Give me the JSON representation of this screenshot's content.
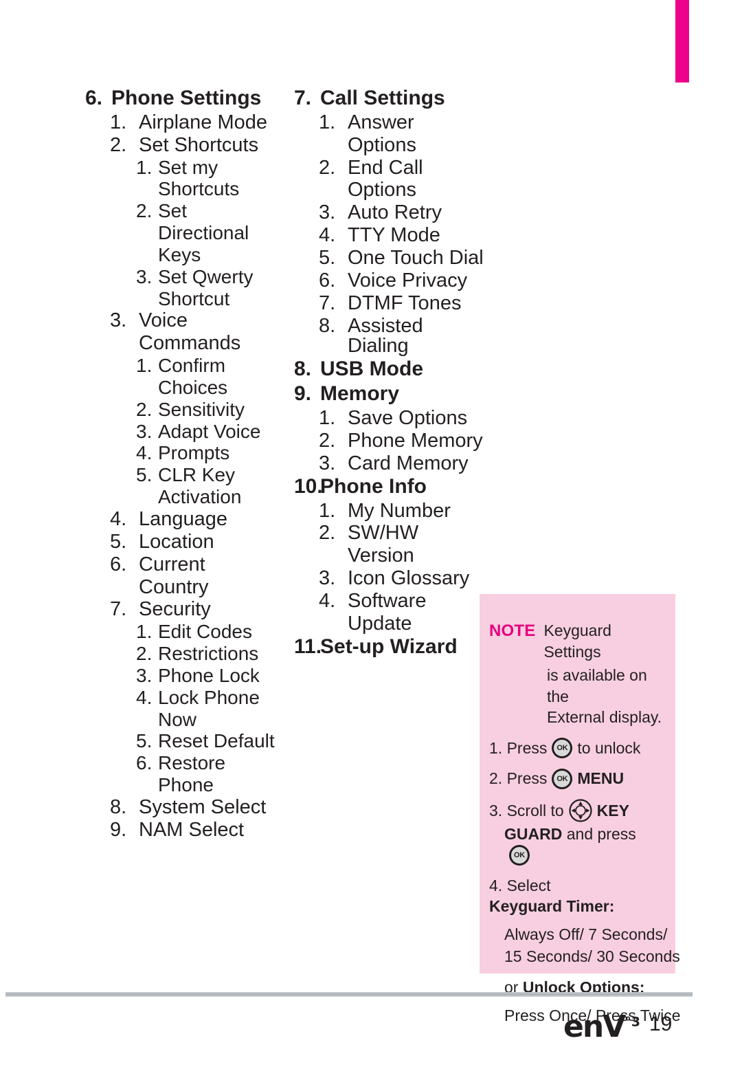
{
  "page": {
    "number": "19",
    "logo_main": "enV",
    "logo_sup": "°3",
    "tab_color": "#ec008c",
    "note_bg_color": "#f7cfe0",
    "note_label_color": "#e6007e"
  },
  "columns": {
    "left": [
      {
        "level": 0,
        "num": "6.",
        "text": "Phone Settings"
      },
      {
        "level": 1,
        "num": "1.",
        "text": "Airplane Mode"
      },
      {
        "level": 1,
        "num": "2.",
        "text": "Set Shortcuts"
      },
      {
        "level": 2,
        "num": "1.",
        "text": "Set my"
      },
      {
        "level": 2,
        "num": "",
        "text": "Shortcuts"
      },
      {
        "level": 2,
        "num": "2.",
        "text": "Set"
      },
      {
        "level": 2,
        "num": "",
        "text": "Directional"
      },
      {
        "level": 2,
        "num": "",
        "text": "Keys"
      },
      {
        "level": 2,
        "num": "3.",
        "text": "Set Qwerty"
      },
      {
        "level": 2,
        "num": "",
        "text": "Shortcut"
      },
      {
        "level": 1,
        "num": "3.",
        "text": "Voice"
      },
      {
        "level": 1,
        "num": "",
        "text": "Commands"
      },
      {
        "level": 2,
        "num": "1.",
        "text": "Confirm"
      },
      {
        "level": 2,
        "num": "",
        "text": "Choices"
      },
      {
        "level": 2,
        "num": "2.",
        "text": "Sensitivity"
      },
      {
        "level": 2,
        "num": "3.",
        "text": "Adapt Voice"
      },
      {
        "level": 2,
        "num": "4.",
        "text": "Prompts"
      },
      {
        "level": 2,
        "num": "5.",
        "text": "CLR Key"
      },
      {
        "level": 2,
        "num": "",
        "text": "Activation"
      },
      {
        "level": 1,
        "num": "4.",
        "text": "Language"
      },
      {
        "level": 1,
        "num": "5.",
        "text": "Location"
      },
      {
        "level": 1,
        "num": "6.",
        "text": "Current"
      },
      {
        "level": 1,
        "num": "",
        "text": "Country"
      },
      {
        "level": 1,
        "num": "7.",
        "text": "Security"
      },
      {
        "level": 2,
        "num": "1.",
        "text": "Edit Codes"
      },
      {
        "level": 2,
        "num": "2.",
        "text": "Restrictions"
      },
      {
        "level": 2,
        "num": "3.",
        "text": "Phone Lock"
      },
      {
        "level": 2,
        "num": "4.",
        "text": "Lock Phone"
      },
      {
        "level": 2,
        "num": "",
        "text": "Now"
      },
      {
        "level": 2,
        "num": "5.",
        "text": "Reset Default"
      },
      {
        "level": 2,
        "num": "6.",
        "text": "Restore"
      },
      {
        "level": 2,
        "num": "",
        "text": "Phone"
      },
      {
        "level": 1,
        "num": "8.",
        "text": "System Select"
      },
      {
        "level": 1,
        "num": "9.",
        "text": "NAM Select"
      }
    ],
    "middle": [
      {
        "level": 0,
        "num": "7.",
        "text": "Call Settings"
      },
      {
        "level": 1,
        "num": "1.",
        "text": "Answer"
      },
      {
        "level": 1,
        "num": "",
        "text": "Options"
      },
      {
        "level": 1,
        "num": "2.",
        "text": "End Call"
      },
      {
        "level": 1,
        "num": "",
        "text": "Options"
      },
      {
        "level": 1,
        "num": "3.",
        "text": "Auto Retry"
      },
      {
        "level": 1,
        "num": "4.",
        "text": "TTY Mode"
      },
      {
        "level": 1,
        "num": "5.",
        "text": "One Touch Dial"
      },
      {
        "level": 1,
        "num": "6.",
        "text": "Voice Privacy"
      },
      {
        "level": 1,
        "num": "7.",
        "text": "DTMF Tones"
      },
      {
        "level": 1,
        "num": "8.",
        "text": "Assisted Dialing"
      },
      {
        "level": 0,
        "num": "8.",
        "text": "USB Mode"
      },
      {
        "level": 0,
        "num": "9.",
        "text": "Memory"
      },
      {
        "level": 1,
        "num": "1.",
        "text": "Save Options"
      },
      {
        "level": 1,
        "num": "2.",
        "text": "Phone Memory"
      },
      {
        "level": 1,
        "num": "3.",
        "text": "Card Memory"
      },
      {
        "level": 0,
        "num": "10.",
        "text": "Phone Info"
      },
      {
        "level": 1,
        "num": "1.",
        "text": "My Number"
      },
      {
        "level": 1,
        "num": "2.",
        "text": "SW/HW"
      },
      {
        "level": 1,
        "num": "",
        "text": "Version"
      },
      {
        "level": 1,
        "num": "3.",
        "text": "Icon Glossary"
      },
      {
        "level": 1,
        "num": "4.",
        "text": "Software"
      },
      {
        "level": 1,
        "num": "",
        "text": "Update"
      },
      {
        "level": 0,
        "num": "11.",
        "text": "Set-up Wizard"
      }
    ]
  },
  "note": {
    "label": "NOTE",
    "head_line1": "Keyguard Settings",
    "head_line2": "is available on the",
    "head_line3": "External display.",
    "step1_num": "1.",
    "step1_a": "Press",
    "step1_b": "to unlock",
    "step2_num": "2.",
    "step2_a": "Press",
    "step2_b": "MENU",
    "step3_num": "3.",
    "step3_a": "Scroll to",
    "step3_b": "KEY",
    "step3_c": "GUARD",
    "step3_d": "and press",
    "step4_num": "4.",
    "step4_a": "Select",
    "step4_b": "Keyguard Timer",
    "step4_colon": ":",
    "timer_line1": "Always Off/ 7 Seconds/",
    "timer_line2": "15 Seconds/ 30 Seconds",
    "unlock_or": "or",
    "unlock_label": "Unlock Options",
    "unlock_colon": ":",
    "unlock_values": "Press Once/ Press Twice"
  },
  "icons": {
    "ok_key": "ok-key-icon",
    "nav_key": "directional-pad-icon"
  }
}
